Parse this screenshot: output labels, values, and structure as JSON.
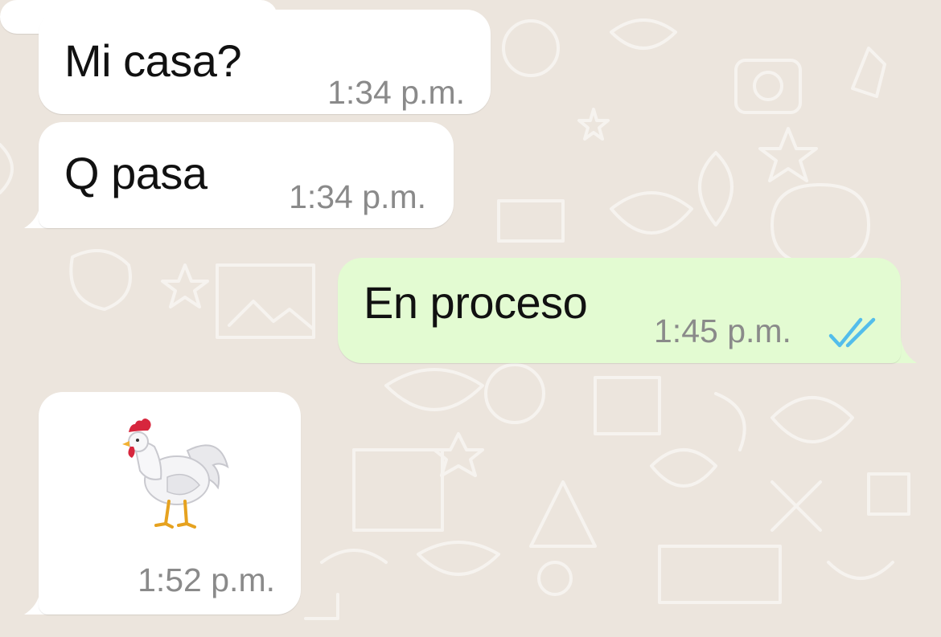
{
  "chat": {
    "messages": [
      {
        "direction": "incoming",
        "text": "Mi casa?",
        "time": "1:34 p.m."
      },
      {
        "direction": "incoming",
        "text": "Q pasa",
        "time": "1:34 p.m."
      },
      {
        "direction": "outgoing",
        "text": "En proceso",
        "time": "1:45 p.m.",
        "status_icon": "double-check-read-icon"
      },
      {
        "direction": "incoming",
        "sticker": "rooster-emoji",
        "time": "1:52 p.m."
      }
    ]
  },
  "colors": {
    "wallpaper": "#ece5dd",
    "incoming_bubble": "#ffffff",
    "outgoing_bubble": "#e3fbd2",
    "timestamp": "#8a8a8a",
    "read_ticks": "#53bdeb"
  }
}
